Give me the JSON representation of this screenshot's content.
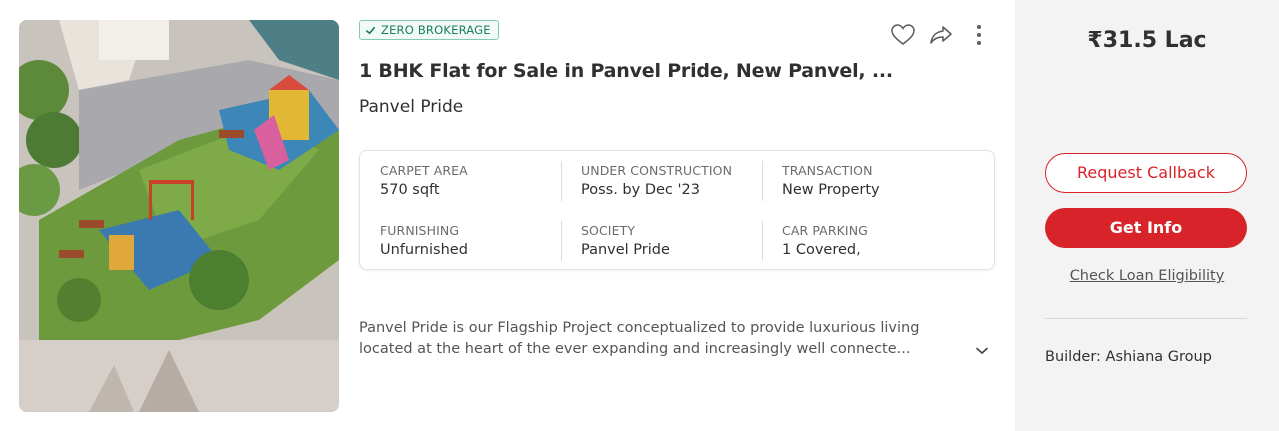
{
  "listing": {
    "badge": "ZERO BROKERAGE",
    "title": "1 BHK Flat for Sale in Panvel Pride, New Panvel, ...",
    "project": "Panvel Pride",
    "summary": [
      {
        "label": "CARPET AREA",
        "value": "570 sqft"
      },
      {
        "label": "UNDER CONSTRUCTION",
        "value": "Poss. by Dec '23"
      },
      {
        "label": "TRANSACTION",
        "value": "New Property"
      },
      {
        "label": "FURNISHING",
        "value": "Unfurnished"
      },
      {
        "label": "SOCIETY",
        "value": "Panvel Pride"
      },
      {
        "label": "CAR PARKING",
        "value": "1 Covered,"
      }
    ],
    "description_line1": "Panvel Pride is our Flagship Project conceptualized to provide luxurious living",
    "description_line2": "located at the heart of the ever expanding and increasingly well connecte...",
    "icons": [
      "heart-icon",
      "share-icon",
      "more-vertical-icon",
      "chevron-down-icon",
      "check-icon"
    ]
  },
  "sidebar": {
    "price": "₹31.5 Lac",
    "request_callback": "Request Callback",
    "get_info": "Get Info",
    "loan_link": "Check Loan Eligibility",
    "builder": "Builder: Ashiana Group"
  },
  "colors": {
    "accent_red": "#d8232a",
    "badge_green": "#1a7d5c",
    "side_bg": "#f3f3f3"
  }
}
